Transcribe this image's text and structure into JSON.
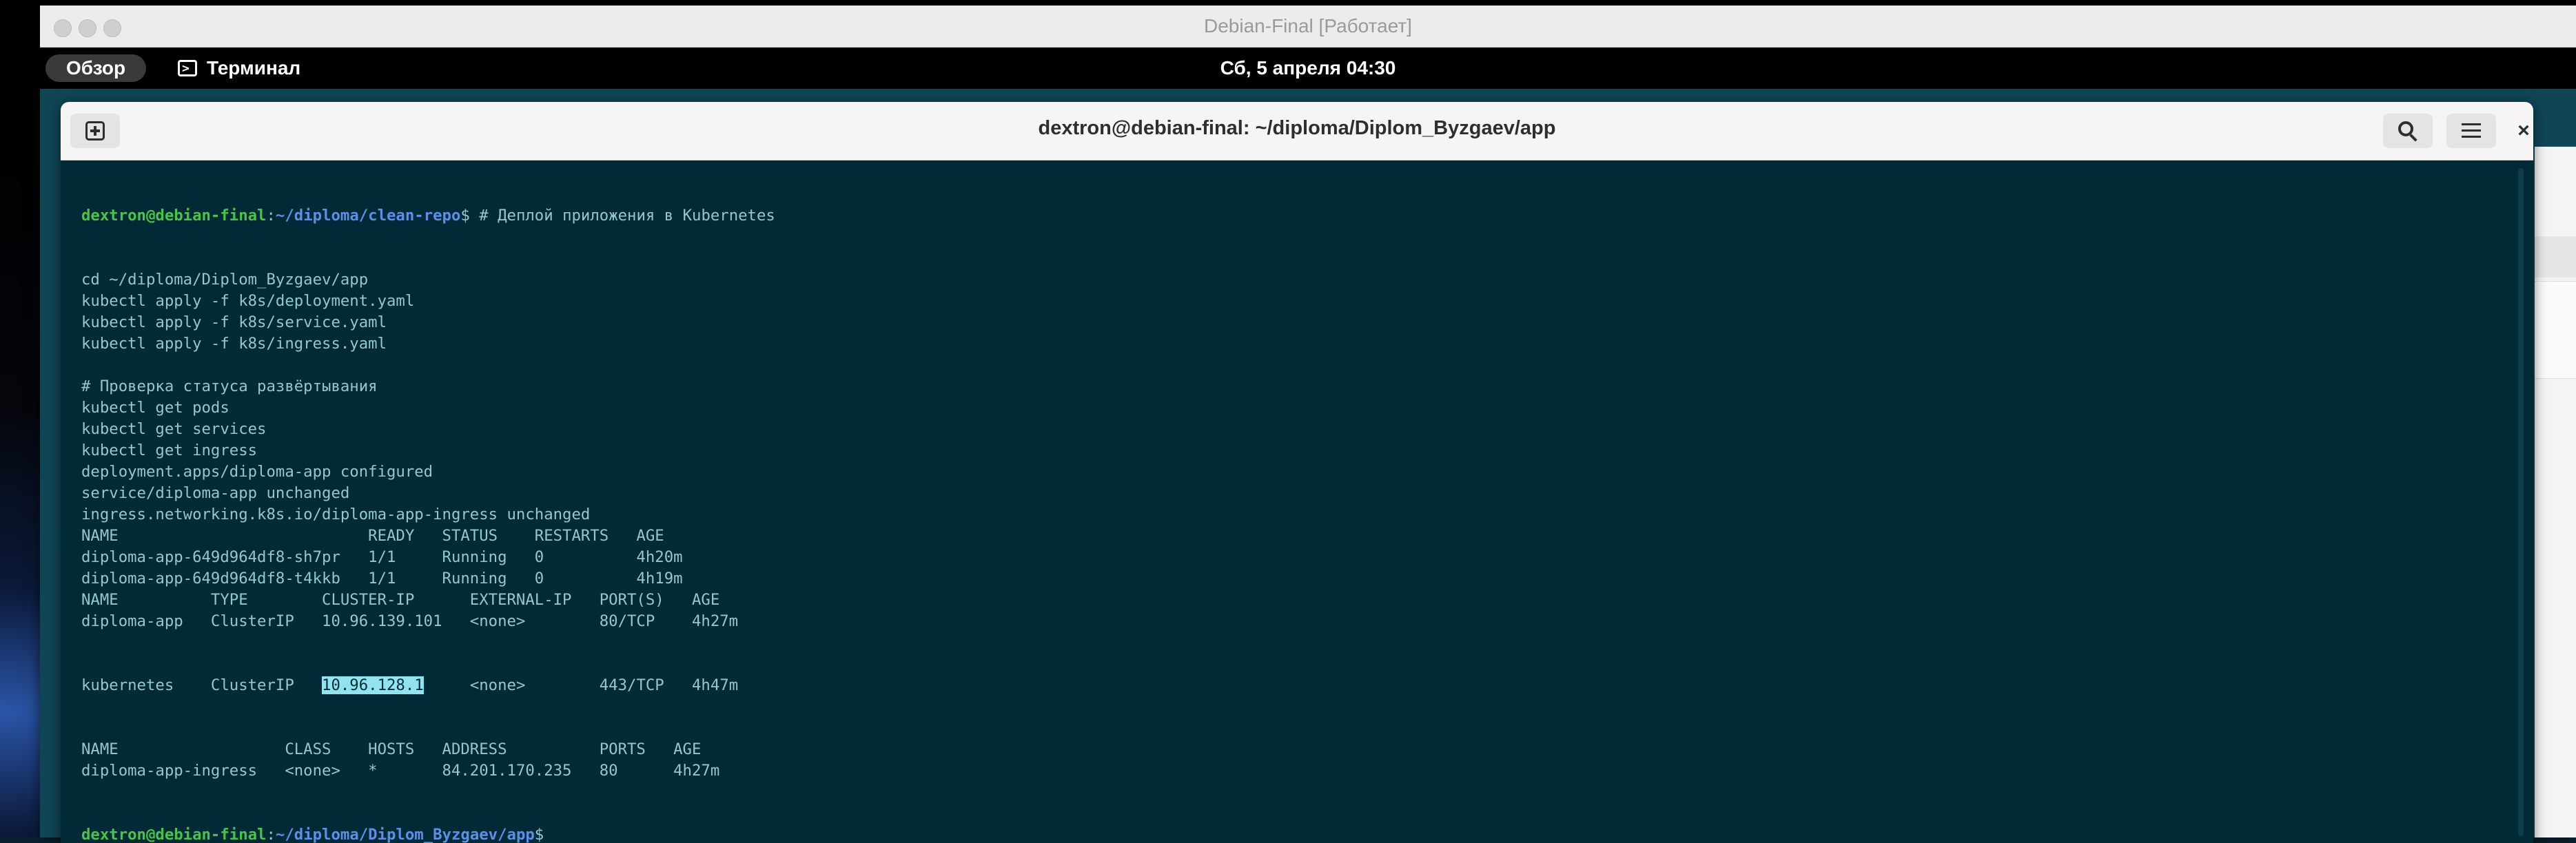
{
  "vm_window": {
    "title": "Debian-Final [Работает]"
  },
  "gnome_topbar": {
    "activities_label": "Обзор",
    "app_name": "Терминал",
    "clock": "Сб, 5 апреля  04:30"
  },
  "terminal": {
    "title": "dextron@debian-final: ~/diploma/Diplom_Byzgaev/app",
    "icons": {
      "new_tab": "new-tab-icon",
      "search": "search-icon",
      "menu": "hamburger-icon",
      "close": "close-icon"
    },
    "close_label": "×",
    "prompt1": {
      "user": "dextron@debian-final",
      "colon": ":",
      "path": "~/diploma/clean-repo",
      "symbol": "$",
      "command": " # Деплой приложения в Kubernetes"
    },
    "lines": [
      "cd ~/diploma/Diplom_Byzgaev/app",
      "kubectl apply -f k8s/deployment.yaml",
      "kubectl apply -f k8s/service.yaml",
      "kubectl apply -f k8s/ingress.yaml",
      "",
      "# Проверка статуса развёртывания",
      "kubectl get pods",
      "kubectl get services",
      "kubectl get ingress",
      "deployment.apps/diploma-app configured",
      "service/diploma-app unchanged",
      "ingress.networking.k8s.io/diploma-app-ingress unchanged",
      "NAME                           READY   STATUS    RESTARTS   AGE",
      "diploma-app-649d964df8-sh7pr   1/1     Running   0          4h20m",
      "diploma-app-649d964df8-t4kkb   1/1     Running   0          4h19m",
      "NAME          TYPE        CLUSTER-IP      EXTERNAL-IP   PORT(S)   AGE",
      "diploma-app   ClusterIP   10.96.139.101   <none>        80/TCP    4h27m"
    ],
    "kubernetes_row": {
      "before": "kubernetes    ClusterIP   ",
      "selected": "10.96.128.1",
      "after": "     <none>        443/TCP   4h47m"
    },
    "lines_after": [
      "NAME                  CLASS    HOSTS   ADDRESS          PORTS   AGE",
      "diploma-app-ingress   <none>   *       84.201.170.235   80      4h27m"
    ],
    "prompt2": {
      "user": "dextron@debian-final",
      "colon": ":",
      "path": "~/diploma/Diplom_Byzgaev/app",
      "symbol": "$"
    }
  },
  "colors": {
    "terminal_bg": "#002b36",
    "prompt_user": "#4ac34a",
    "prompt_path": "#5b8fe8",
    "selection": "#8fe4ef"
  }
}
